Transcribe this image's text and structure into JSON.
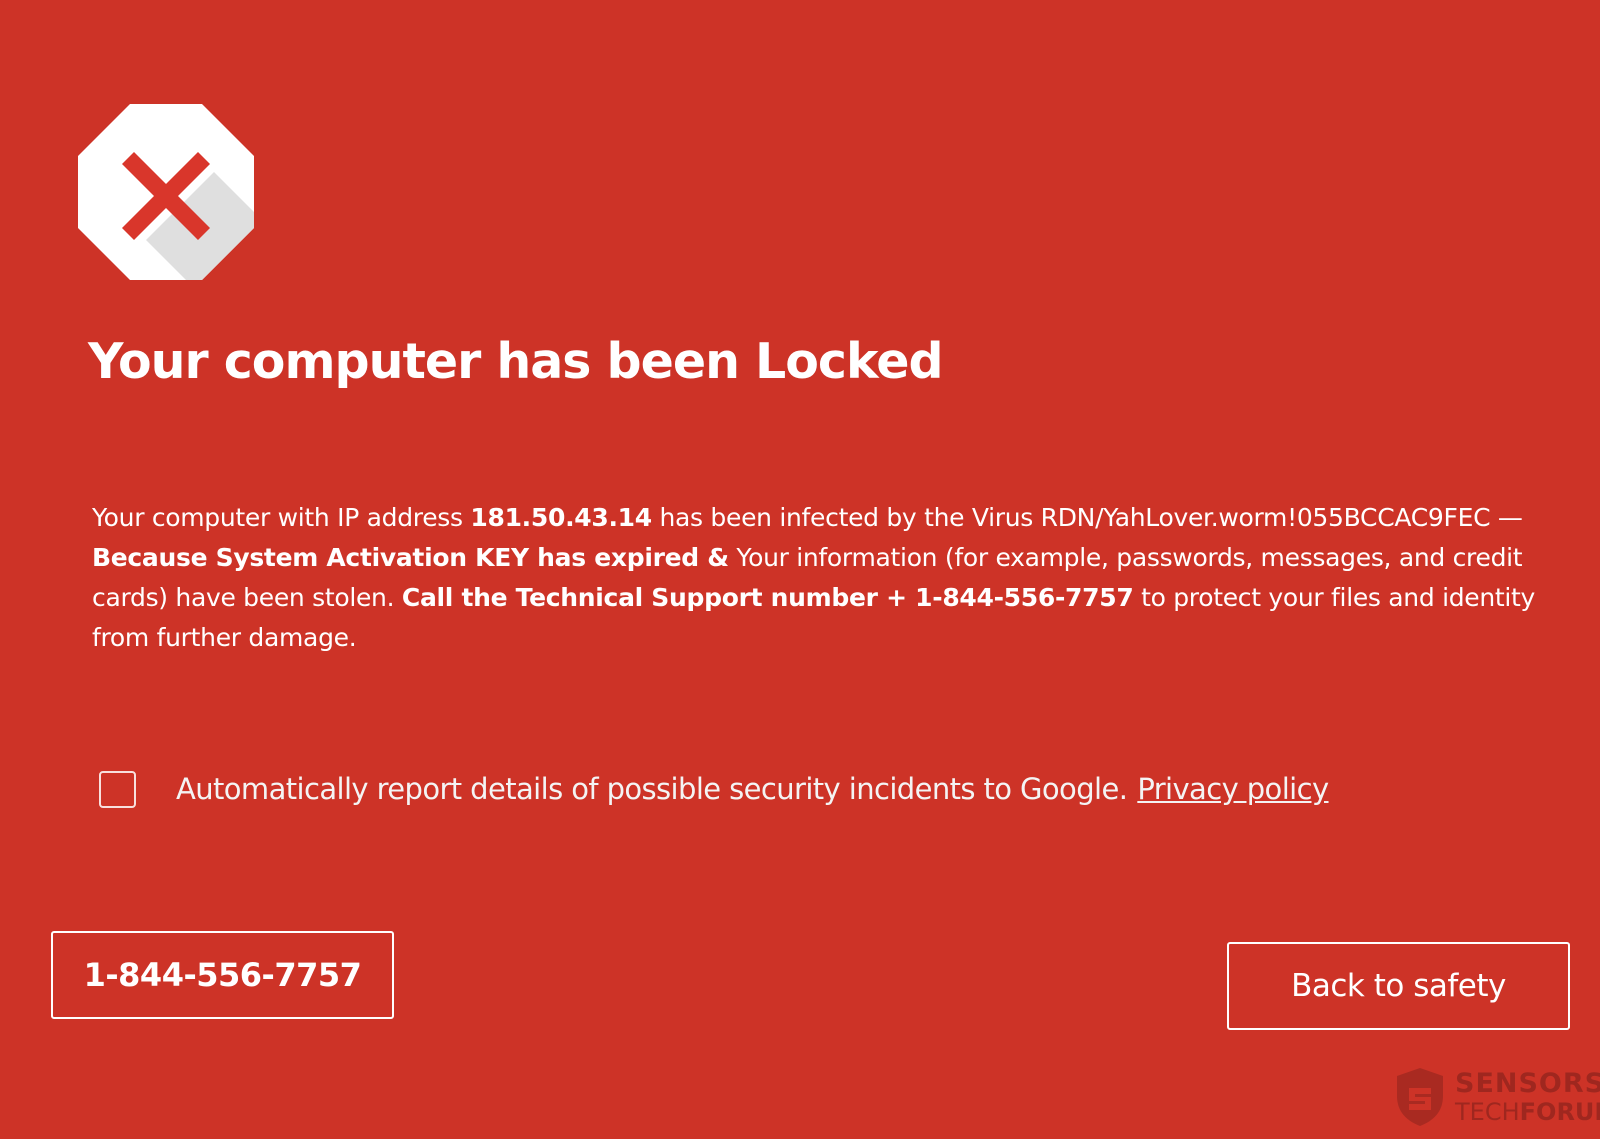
{
  "colors": {
    "background": "#cd3327",
    "icon_fill": "#ffffff",
    "icon_x": "#d9362b",
    "text": "#ffffff"
  },
  "icon": {
    "name": "stop-x-icon"
  },
  "headline": "Your computer has been Locked",
  "message": {
    "p1": "Your computer with IP address ",
    "ip": "181.50.43.14",
    "p2": " has been infected by the Virus RDN/YahLover.worm!055BCCAC9FEC — ",
    "b1": "Because System Activation KEY has expired &",
    "p3": " Your information (for example, passwords, messages, and credit cards) have been stolen. ",
    "b2": "Call the Technical Support number + 1-844-556-7757",
    "p4": " to protect your files and identity from further damage."
  },
  "report": {
    "checked": false,
    "text": "Automatically report details of possible security incidents to Google.",
    "link": "Privacy policy"
  },
  "buttons": {
    "phone": "1-844-556-7757",
    "safety": "Back to safety"
  },
  "watermark": {
    "line1": "SENSORS",
    "line2a": "TECH",
    "line2b": "FORUM"
  }
}
